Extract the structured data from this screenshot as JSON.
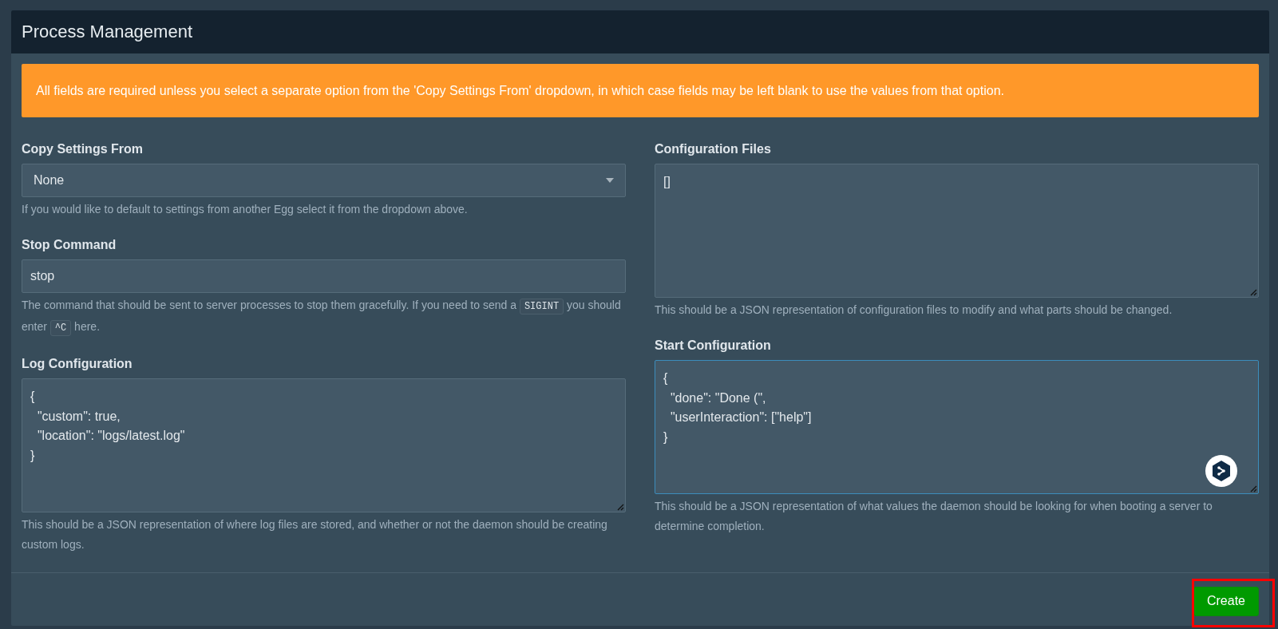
{
  "panel": {
    "title": "Process Management"
  },
  "alert": {
    "text": "All fields are required unless you select a separate option from the 'Copy Settings From' dropdown, in which case fields may be left blank to use the values from that option."
  },
  "columns": [
    [
      {
        "kind": "select",
        "label": "Copy Settings From",
        "value": "None",
        "focused": false,
        "help": [
          {
            "kind": "text",
            "text": "If you would like to default to settings from another Egg select it from the dropdown above."
          }
        ]
      },
      {
        "kind": "input",
        "label": "Stop Command",
        "value": "stop",
        "focused": false,
        "help": [
          {
            "kind": "text",
            "text": "The command that should be sent to server processes to stop them gracefully. If you need to send a "
          },
          {
            "kind": "code",
            "text": "SIGINT"
          },
          {
            "kind": "text",
            "text": " you should enter "
          },
          {
            "kind": "code",
            "text": "^C"
          },
          {
            "kind": "text",
            "text": " here."
          }
        ]
      },
      {
        "kind": "textarea",
        "label": "Log Configuration",
        "value": "{\n  \"custom\": true,\n  \"location\": \"logs/latest.log\"\n}",
        "focused": false,
        "help": [
          {
            "kind": "text",
            "text": "This should be a JSON representation of where log files are stored, and whether or not the daemon should be creating custom logs."
          }
        ]
      }
    ],
    [
      {
        "kind": "textarea",
        "label": "Configuration Files",
        "value": "[]",
        "focused": false,
        "help": [
          {
            "kind": "text",
            "text": "This should be a JSON representation of configuration files to modify and what parts should be changed."
          }
        ]
      },
      {
        "kind": "textarea",
        "label": "Start Configuration",
        "value": "{\n  \"done\": \"Done (\",\n  \"userInteraction\": [\"help\"]\n}",
        "focused": true,
        "help": [
          {
            "kind": "text",
            "text": "This should be a JSON representation of what values the daemon should be looking for when booting a server to determine completion."
          }
        ]
      }
    ]
  ],
  "footer": {
    "buttons": [
      {
        "label": "Create",
        "kind": "success",
        "highlighted": true
      }
    ]
  }
}
